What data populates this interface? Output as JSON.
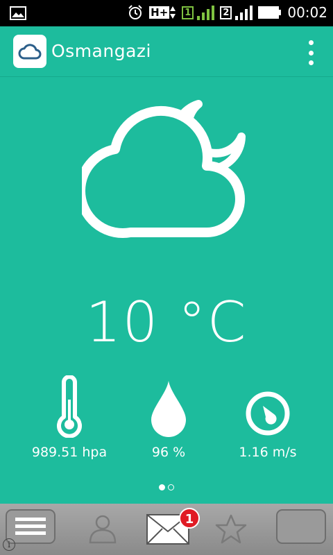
{
  "status_bar": {
    "time": "00:02",
    "network_type": "H+",
    "sim1_label": "1",
    "sim2_label": "2",
    "icons": [
      "image-notification-icon",
      "alarm-icon",
      "data-arrows-icon",
      "signal-icon",
      "battery-icon"
    ]
  },
  "app_bar": {
    "title": "Osmangazi",
    "icon": "cloud-app-icon",
    "menu_icon": "overflow-menu-icon"
  },
  "weather": {
    "condition_icon": "cloudy-night-icon",
    "temperature": "10 °C"
  },
  "stats": [
    {
      "icon": "thermometer-icon",
      "label": "989.51 hpa"
    },
    {
      "icon": "humidity-drop-icon",
      "label": "96 %"
    },
    {
      "icon": "wind-gauge-icon",
      "label": "1.16 m/s"
    }
  ],
  "pager": {
    "active_index": 0,
    "count": 2
  },
  "nav_bar": {
    "items": [
      "menu-icon",
      "contacts-icon",
      "mail-icon",
      "favorites-icon",
      "window-icon"
    ],
    "mail_badge": "1"
  },
  "colors": {
    "primary": "#1dbc9d",
    "white": "#ffffff",
    "badge_red": "#e01b24"
  }
}
